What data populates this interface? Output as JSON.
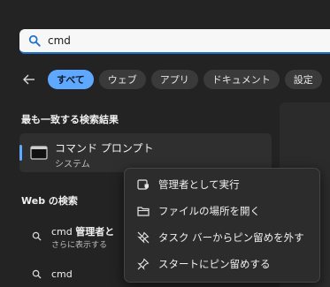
{
  "search": {
    "query": "cmd"
  },
  "filters": {
    "tabs": [
      {
        "label": "すべて"
      },
      {
        "label": "ウェブ"
      },
      {
        "label": "アプリ"
      },
      {
        "label": "ドキュメント"
      },
      {
        "label": "設定"
      }
    ]
  },
  "best_match": {
    "heading": "最も一致する検索結果",
    "name": "コマンド プロンプト",
    "type": "システム"
  },
  "web": {
    "heading": "Web の検索",
    "items": [
      {
        "prefix": "cmd ",
        "bold": "管理者と",
        "sub": "さらに表示する"
      },
      {
        "prefix": "cmd",
        "bold": "",
        "sub": ""
      }
    ]
  },
  "context_menu": {
    "items": [
      {
        "label": "管理者として実行",
        "icon": "shield-run-icon"
      },
      {
        "label": "ファイルの場所を開く",
        "icon": "folder-icon"
      },
      {
        "label": "タスク バーからピン留めを外す",
        "icon": "unpin-icon"
      },
      {
        "label": "スタートにピン留めする",
        "icon": "pin-icon"
      }
    ]
  },
  "colors": {
    "accent": "#5fa8ff",
    "background": "#232323",
    "menu": "#2c2c2c"
  }
}
